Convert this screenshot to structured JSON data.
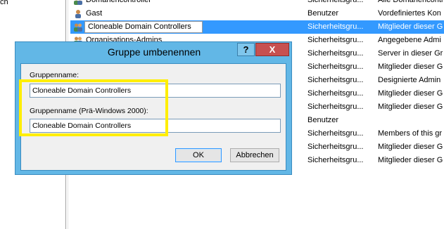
{
  "left_pane": {
    "fragment": "ch"
  },
  "list": {
    "rows": [
      {
        "name": "Domänencontroller",
        "type": "Sicherheitsgru...",
        "desc": "Alle Domänencontr",
        "icon": "group-icon"
      },
      {
        "name": "Gast",
        "type": "Benutzer",
        "desc": "Vordefiniertes Kon",
        "icon": "user-icon"
      },
      {
        "name": "Cloneable Domain Controllers",
        "type": "Sicherheitsgru...",
        "desc": "Mitglieder dieser G",
        "icon": "group-icon",
        "selected": true
      },
      {
        "name": "Organisations-Admins",
        "type": "Sicherheitsgru...",
        "desc": "Angegebene Admi",
        "icon": "group-icon"
      },
      {
        "name": "",
        "type": "Sicherheitsgru...",
        "desc": "Server in dieser Gr",
        "icon": ""
      },
      {
        "name": "",
        "type": "Sicherheitsgru...",
        "desc": "Mitglieder dieser G",
        "icon": ""
      },
      {
        "name": "",
        "type": "Sicherheitsgru...",
        "desc": "Designierte Admin",
        "icon": ""
      },
      {
        "name": "",
        "type": "Sicherheitsgru...",
        "desc": "Mitglieder dieser G",
        "icon": ""
      },
      {
        "name": "",
        "type": "Sicherheitsgru...",
        "desc": "Mitglieder dieser G",
        "icon": ""
      },
      {
        "name": "",
        "type": "Benutzer",
        "desc": "",
        "icon": ""
      },
      {
        "name": "",
        "type": "Sicherheitsgru...",
        "desc": "Members of this gr",
        "icon": ""
      },
      {
        "name": "",
        "type": "Sicherheitsgru...",
        "desc": "Mitglieder dieser G",
        "icon": ""
      },
      {
        "name": "",
        "type": "Sicherheitsgru...",
        "desc": "Mitglieder dieser G",
        "icon": ""
      }
    ]
  },
  "dialog": {
    "title": "Gruppe umbenennen",
    "help_label": "?",
    "close_label": "X",
    "group_name_label": "Gruppenname:",
    "group_name_value": "Cloneable Domain Controllers",
    "group_name_pre2000_label": "Gruppenname (Prä-Windows 2000):",
    "group_name_pre2000_value": "Cloneable Domain Controllers",
    "ok_label": "OK",
    "cancel_label": "Abbrechen"
  },
  "colors": {
    "selection": "#3399ff",
    "dialog_frame": "#62b7e6",
    "close_button": "#c75050",
    "highlight": "#ffee00"
  }
}
